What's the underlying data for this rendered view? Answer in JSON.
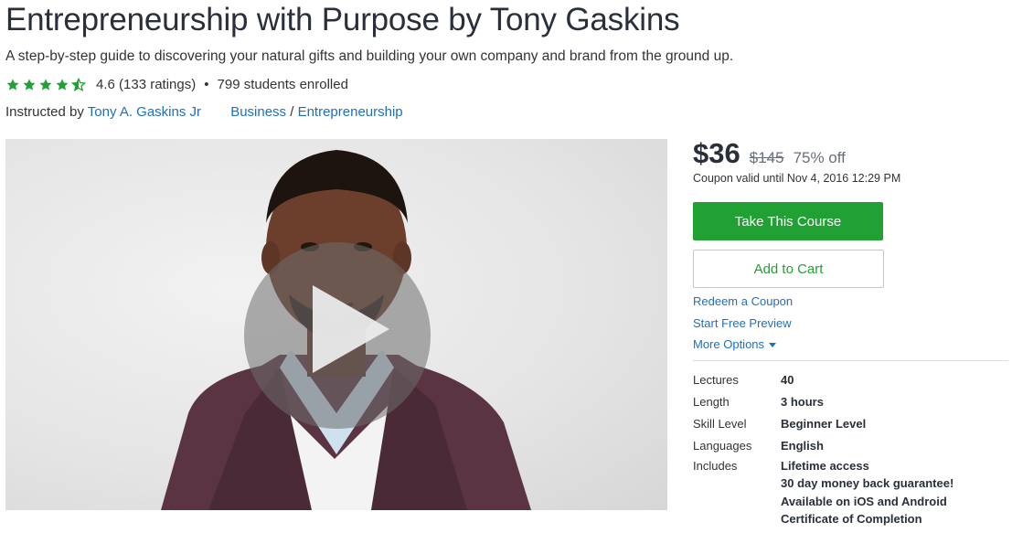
{
  "course": {
    "title": "Entrepreneurship with Purpose by Tony Gaskins",
    "subtitle": "A step-by-step guide to discovering your natural gifts and building your own company and brand from the ground up.",
    "rating": "4.6",
    "ratings_count": "(133 ratings)",
    "stars_filled": 4.5,
    "separator": "•",
    "students": "799 students enrolled",
    "instructed_by": "Instructed by",
    "instructor": "Tony A. Gaskins Jr",
    "category": "Business",
    "category_sep": "/",
    "subcategory": "Entrepreneurship"
  },
  "video": {
    "play_icon": "play-icon"
  },
  "pricing": {
    "price": "$36",
    "original_price": "$145",
    "discount": "75% off",
    "coupon_text": "Coupon valid until Nov 4, 2016 12:29 PM"
  },
  "actions": {
    "take_course": "Take This Course",
    "add_to_cart": "Add to Cart",
    "redeem_coupon": "Redeem a Coupon",
    "free_preview": "Start Free Preview",
    "more_options": "More Options",
    "more_options_icon": "caret-down-icon"
  },
  "details": [
    {
      "label": "Lectures",
      "value": "40"
    },
    {
      "label": "Length",
      "value": "3 hours"
    },
    {
      "label": "Skill Level",
      "value": "Beginner Level"
    },
    {
      "label": "Languages",
      "value": "English"
    }
  ],
  "includes": {
    "label": "Includes",
    "items": [
      "Lifetime access",
      "30 day money back guarantee!",
      "Available on iOS and Android",
      "Certificate of Completion"
    ]
  },
  "colors": {
    "accent": "#21a134",
    "link": "#1e6fbf",
    "star": "#21a134"
  }
}
